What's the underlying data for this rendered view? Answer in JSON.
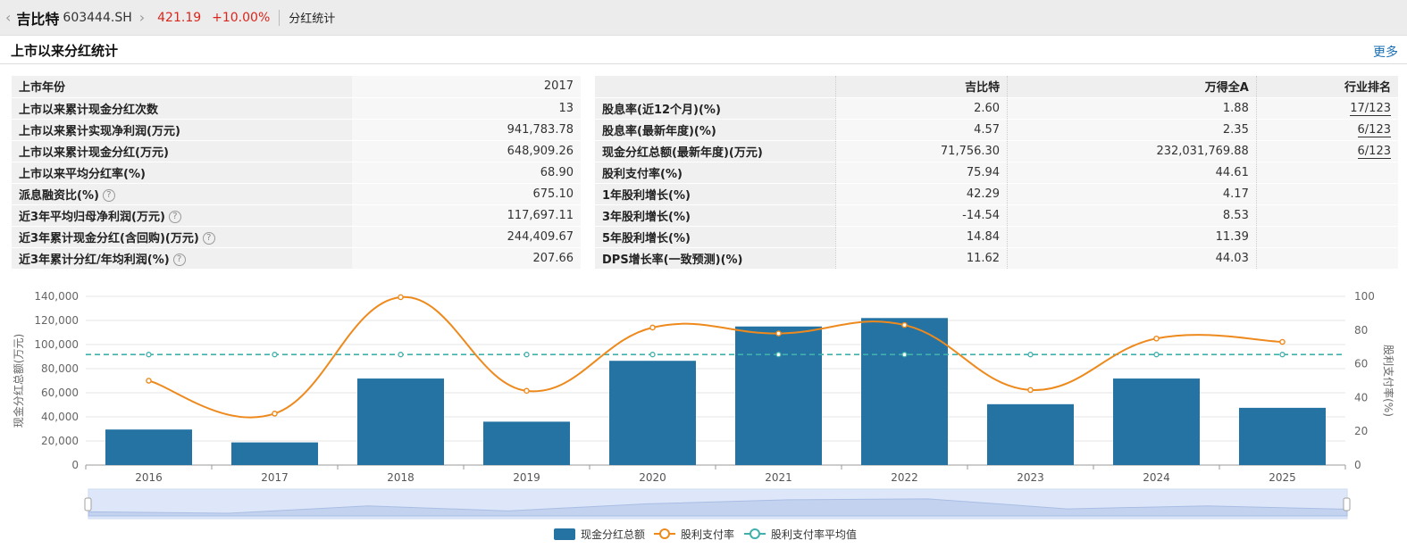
{
  "header": {
    "stock_name": "吉比特",
    "stock_code": "603444.SH",
    "price": "421.19",
    "change": "+10.00%",
    "breadcrumb": "分红统计"
  },
  "section": {
    "title": "上市以来分红统计",
    "more_label": "更多"
  },
  "summary": [
    {
      "label": "上市年份",
      "value": "2017",
      "help": false
    },
    {
      "label": "上市以来累计现金分红次数",
      "value": "13",
      "help": false
    },
    {
      "label": "上市以来累计实现净利润(万元)",
      "value": "941,783.78",
      "help": false
    },
    {
      "label": "上市以来累计现金分红(万元)",
      "value": "648,909.26",
      "help": false
    },
    {
      "label": "上市以来平均分红率(%)",
      "value": "68.90",
      "help": false
    },
    {
      "label": "派息融资比(%)",
      "value": "675.10",
      "help": true
    },
    {
      "label": "近3年平均归母净利润(万元)",
      "value": "117,697.11",
      "help": true
    },
    {
      "label": "近3年累计现金分红(含回购)(万元)",
      "value": "244,409.67",
      "help": true
    },
    {
      "label": "近3年累计分红/年均利润(%)",
      "value": "207.66",
      "help": true
    }
  ],
  "comparison": {
    "headers": [
      "",
      "吉比特",
      "万得全A",
      "行业排名"
    ],
    "rows": [
      {
        "label": "股息率(近12个月)(%)",
        "company": "2.60",
        "market": "1.88",
        "rank": "17/123"
      },
      {
        "label": "股息率(最新年度)(%)",
        "company": "4.57",
        "market": "2.35",
        "rank": "6/123"
      },
      {
        "label": "现金分红总额(最新年度)(万元)",
        "company": "71,756.30",
        "market": "232,031,769.88",
        "rank": "6/123"
      },
      {
        "label": "股利支付率(%)",
        "company": "75.94",
        "market": "44.61",
        "rank": ""
      },
      {
        "label": "1年股利增长(%)",
        "company": "42.29",
        "market": "4.17",
        "rank": ""
      },
      {
        "label": "3年股利增长(%)",
        "company": "-14.54",
        "market": "8.53",
        "rank": ""
      },
      {
        "label": "5年股利增长(%)",
        "company": "14.84",
        "market": "11.39",
        "rank": ""
      },
      {
        "label": "DPS增长率(一致预测)(%)",
        "company": "11.62",
        "market": "44.03",
        "rank": ""
      }
    ]
  },
  "chart_data": {
    "type": "bar",
    "categories": [
      "2016",
      "2017",
      "2018",
      "2019",
      "2020",
      "2021",
      "2022",
      "2023",
      "2024",
      "2025"
    ],
    "ylabel_left": "现金分红总额(万元)",
    "ylabel_right": "股利支付率(%)",
    "ylim_left": [
      0,
      140000
    ],
    "yticks_left": [
      "0",
      "20,000",
      "40,000",
      "60,000",
      "80,000",
      "100,000",
      "120,000",
      "140,000"
    ],
    "ylim_right": [
      0,
      100
    ],
    "yticks_right": [
      "0",
      "20",
      "40",
      "60",
      "80",
      "100"
    ],
    "grid": true,
    "legend_position": "bottom-center",
    "colors": {
      "bar": "#2473a3",
      "line": "#ee8a1d",
      "avg": "#3fb0ab"
    },
    "series": [
      {
        "name": "现金分红总额",
        "type": "bar",
        "axis": "left",
        "values": [
          29500,
          18800,
          71800,
          36000,
          86500,
          115000,
          122000,
          50500,
          71800,
          47500
        ]
      },
      {
        "name": "股利支付率",
        "type": "line",
        "axis": "right",
        "values": [
          50,
          30.5,
          99.5,
          44,
          81.5,
          78,
          83,
          44.5,
          75,
          73
        ]
      },
      {
        "name": "股利支付率平均值",
        "type": "line-dashed",
        "axis": "right",
        "values": [
          65.5,
          65.5,
          65.5,
          65.5,
          65.5,
          65.5,
          65.5,
          65.5,
          65.5,
          65.5
        ]
      }
    ]
  }
}
